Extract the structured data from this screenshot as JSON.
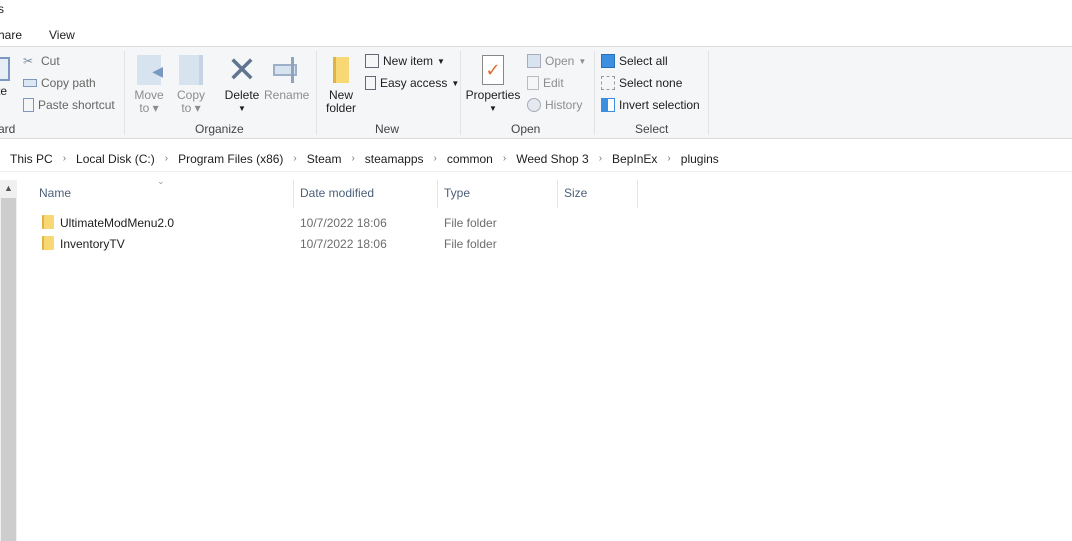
{
  "window": {
    "title_fragment": "s"
  },
  "tabs": [
    {
      "label": "hare"
    },
    {
      "label": "View"
    }
  ],
  "ribbon": {
    "clipboard": {
      "paste_label_fragment": "te",
      "cut": "Cut",
      "copy_path": "Copy path",
      "paste_shortcut": "Paste shortcut",
      "group_label": "ard"
    },
    "organize": {
      "move_to_1": "Move",
      "move_to_2": "to",
      "copy_to_1": "Copy",
      "copy_to_2": "to",
      "delete": "Delete",
      "rename": "Rename",
      "group_label": "Organize"
    },
    "new": {
      "new_folder_1": "New",
      "new_folder_2": "folder",
      "new_item": "New item",
      "easy_access": "Easy access",
      "group_label": "New"
    },
    "open": {
      "properties": "Properties",
      "open": "Open",
      "edit": "Edit",
      "history": "History",
      "group_label": "Open"
    },
    "select": {
      "select_all": "Select all",
      "select_none": "Select none",
      "invert_selection": "Invert selection",
      "group_label": "Select"
    }
  },
  "breadcrumb": [
    "This PC",
    "Local Disk (C:)",
    "Program Files (x86)",
    "Steam",
    "steamapps",
    "common",
    "Weed Shop 3",
    "BepInEx",
    "plugins"
  ],
  "columns": {
    "name": "Name",
    "date": "Date modified",
    "type": "Type",
    "size": "Size"
  },
  "files": [
    {
      "name": "UltimateModMenu2.0",
      "date": "10/7/2022 18:06",
      "type": "File folder",
      "size": ""
    },
    {
      "name": "InventoryTV",
      "date": "10/7/2022 18:06",
      "type": "File folder",
      "size": ""
    }
  ],
  "colors": {
    "accent": "#3c8fe0",
    "folder": "#f8d775",
    "ribbon_bg": "#f5f6f7"
  }
}
